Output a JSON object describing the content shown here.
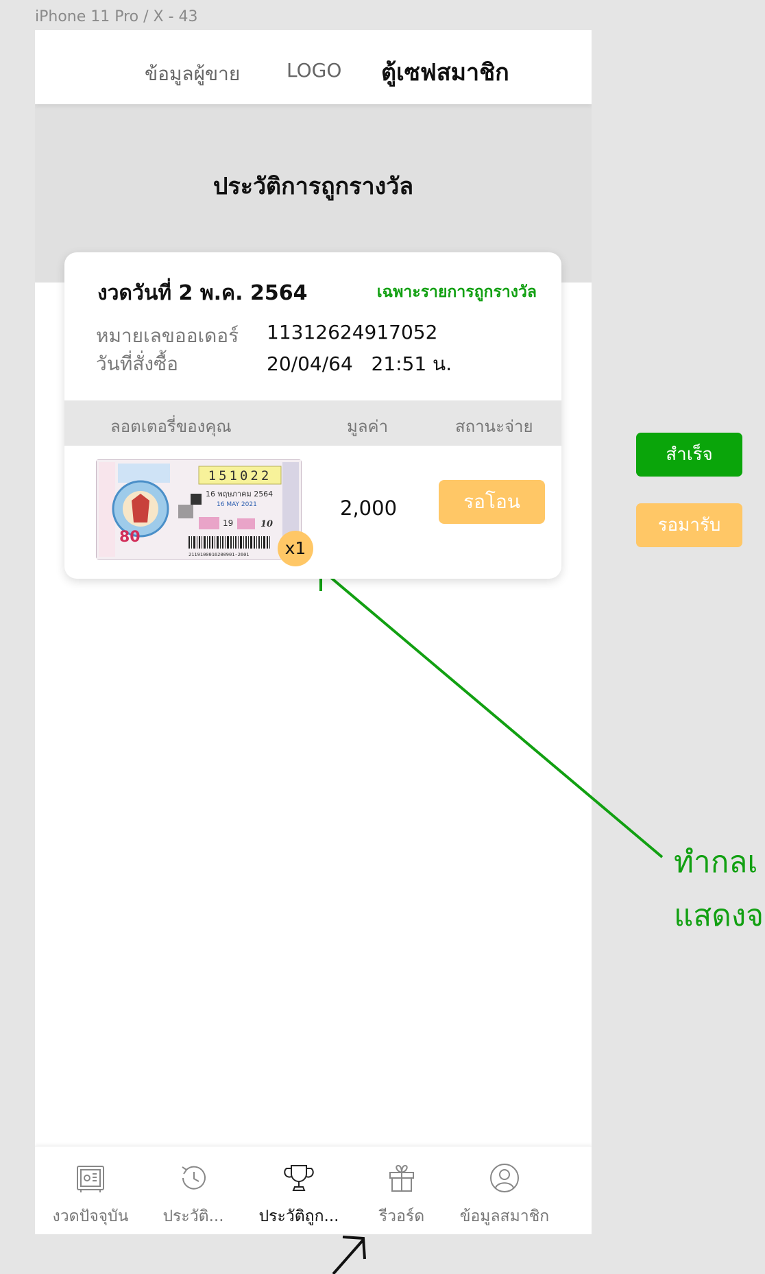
{
  "frame_label": "iPhone 11 Pro / X - 43",
  "header": {
    "seller_info": "ข้อมูลผู้ขาย",
    "logo": "LOGO",
    "brand": "ตู้เซฟสมาชิก"
  },
  "page_title": "ประวัติการถูกรางวัล",
  "card": {
    "round_label": "งวดวันที่ 2 พ.ค. 2564",
    "filter_label": "เฉพาะรายการถูกรางวัล",
    "order_no_label": "หมายเลขออเดอร์",
    "order_no": "11312624917052",
    "order_date_label": "วันที่สั่งซื้อ",
    "order_date": "20/04/64",
    "order_time": "21:51 น.",
    "columns": [
      "ลอตเตอรี่ของคุณ",
      "มูลค่า",
      "สถานะจ่าย"
    ],
    "row": {
      "ticket": {
        "number": "151022",
        "draw_date_th": "16 พฤษภาคม 2564",
        "draw_date_en": "16 MAY 2021",
        "round": "19",
        "set": "10",
        "price": "80",
        "barcode": "2119100016200901-2601"
      },
      "quantity": "x1",
      "amount": "2,000",
      "status": "รอโอน"
    }
  },
  "legend": {
    "success": "สำเร็จ",
    "pending": "รอมารับ"
  },
  "annotation": {
    "line1": "ทำกลเ",
    "line2": "แสดงจ",
    "color": "#12a012"
  },
  "nav": [
    {
      "label": "งวดปัจจุบัน",
      "icon": "safe-icon"
    },
    {
      "label": "ประวัติ...",
      "icon": "history-icon"
    },
    {
      "label": "ประวัติถูก...",
      "icon": "trophy-icon",
      "active": true
    },
    {
      "label": "รีวอร์ด",
      "icon": "gift-icon"
    },
    {
      "label": "ข้อมูลสมาชิก",
      "icon": "user-icon"
    }
  ],
  "colors": {
    "accent_green": "#0aa50a",
    "pending_orange": "#ffc766"
  }
}
